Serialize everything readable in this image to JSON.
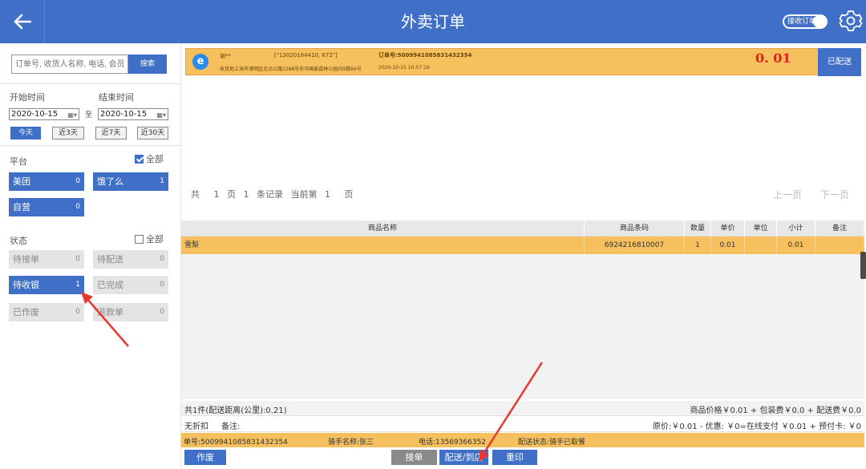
{
  "header": {
    "title": "外卖订单",
    "toggle_label": "接收订单"
  },
  "search": {
    "placeholder": "订单号, 收货人名称, 电话, 会员",
    "button": "搜索"
  },
  "dates": {
    "start_label": "开始时间",
    "end_label": "结束时间",
    "start_value": "2020-10-15",
    "end_value": "2020-10-15",
    "to": "至",
    "ranges": [
      "今天",
      "近3天",
      "近7天",
      "近30天"
    ]
  },
  "platform": {
    "label": "平台",
    "all_label": "全部",
    "items": [
      {
        "name": "美团",
        "count": "0"
      },
      {
        "name": "饿了么",
        "count": "1"
      },
      {
        "name": "自营",
        "count": "0"
      }
    ]
  },
  "status": {
    "label": "状态",
    "all_label": "全部",
    "items": [
      {
        "name": "待接单",
        "count": "0"
      },
      {
        "name": "待配送",
        "count": "0"
      },
      {
        "name": "待收银",
        "count": "1"
      },
      {
        "name": "已完成",
        "count": "0"
      },
      {
        "name": "已作废",
        "count": "0"
      },
      {
        "name": "退款单",
        "count": "0"
      }
    ]
  },
  "order": {
    "customer": "谢**",
    "phones": "[\"13020184410, 672\"]",
    "order_no_label": "订单号:5009941085831432354",
    "address": "收货地上海市浦明区北沿公路2288号东中国家森林公园内9楼66号",
    "time": "2020-10-15 10:57:19",
    "price": "0. 01",
    "status_btn": "已配送"
  },
  "pager": {
    "total_prefix": "共",
    "pages": "1",
    "pages_unit": "页",
    "records": "1",
    "records_unit": "条记录",
    "current_label": "当前第",
    "current": "1",
    "current_unit": "页",
    "prev": "上一页",
    "next": "下一页"
  },
  "table": {
    "headers": [
      "商品名称",
      "商品条码",
      "数量",
      "单价",
      "单位",
      "小计",
      "备注"
    ],
    "rows": [
      [
        "雪梨",
        "6924216810007",
        "1",
        "0.01",
        "",
        "0.01",
        ""
      ]
    ]
  },
  "summary": {
    "count_distance": "共1件(配送距离(公里):0.21)",
    "price_breakdown": "商品价格￥0.01 + 包装费￥0.0 + 配送费￥0.0",
    "discount": "无折扣",
    "note_label": "备注:",
    "payment": "原价:￥0.01 - 优惠: ￥0=在线支付 ￥0.01 + 预付卡: ￥0"
  },
  "info": {
    "order_no": "单号:5009941085831432354",
    "rider": "骑手名称:张三",
    "phone": "电话:13569366352",
    "delivery_status": "配送状态:骑手已取餐"
  },
  "actions": {
    "void": "作废",
    "accept": "接单",
    "deliver": "配送/到店",
    "reprint": "重印"
  },
  "colors": {
    "primary": "#3f6fc6",
    "highlight": "#f6c05f",
    "price": "#e21f1f",
    "arrow": "#e8382f"
  }
}
